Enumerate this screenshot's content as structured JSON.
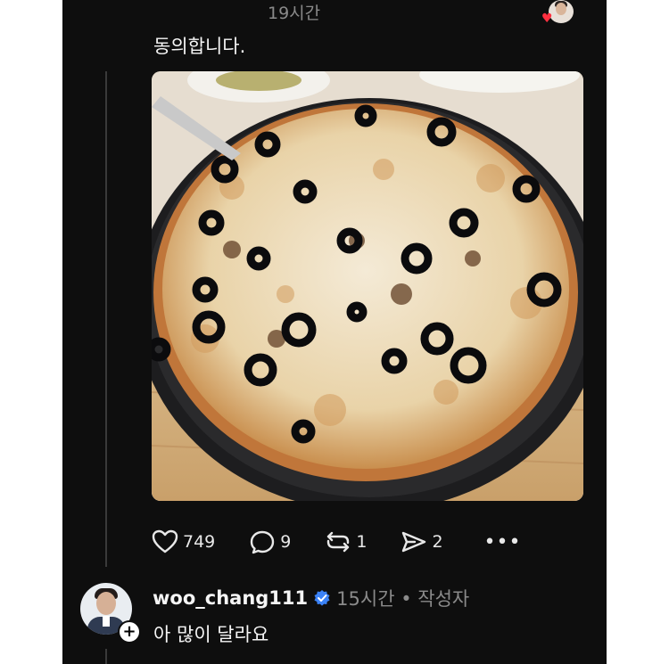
{
  "post": {
    "timestamp": "19시간",
    "text": "동의합니다.",
    "image_alt": "pizza with black olives",
    "stats": {
      "likes": "749",
      "comments": "9",
      "reposts": "1",
      "shares": "2"
    }
  },
  "reply": {
    "username": "woo_chang111",
    "meta": "15시간 • 작성자",
    "text": "아 많이 달라요"
  },
  "colors": {
    "background": "#0e0e0e",
    "like_red": "#ff3040",
    "verified_blue": "#3b82f6",
    "muted_text": "#8a8a8a"
  },
  "icons": [
    "heart-icon",
    "comment-icon",
    "repost-icon",
    "share-icon",
    "more-icon",
    "verified-icon",
    "plus-icon"
  ]
}
